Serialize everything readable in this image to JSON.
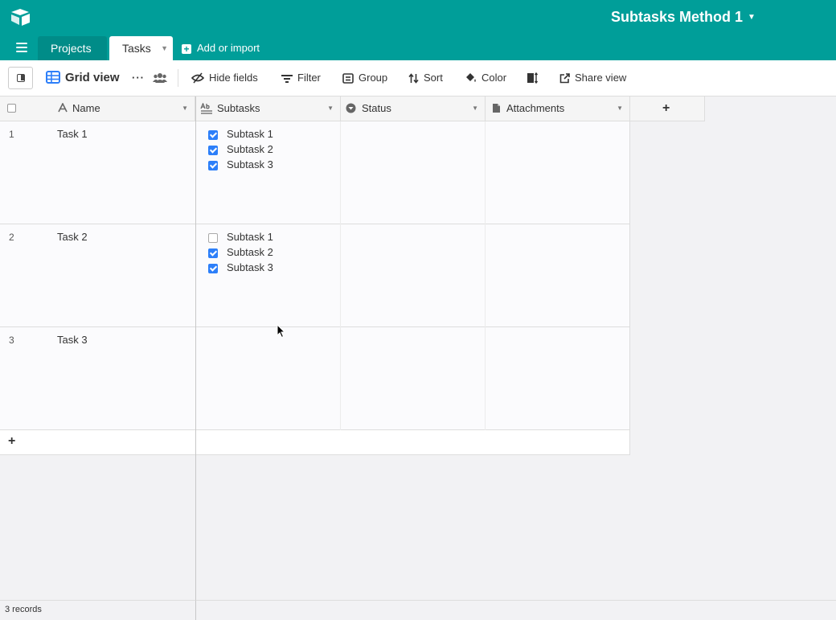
{
  "header": {
    "base_title": "Subtasks Method 1",
    "colors": {
      "brand": "#009e99",
      "accent": "#2d7ff9"
    }
  },
  "tabs": [
    {
      "label": "Projects",
      "active": false
    },
    {
      "label": "Tasks",
      "active": true
    }
  ],
  "add_import_label": "Add or import",
  "toolbar": {
    "view_name": "Grid view",
    "hide_fields": "Hide fields",
    "filter": "Filter",
    "group": "Group",
    "sort": "Sort",
    "color": "Color",
    "share_view": "Share view"
  },
  "columns": [
    {
      "label": "Name",
      "icon": "text-icon"
    },
    {
      "label": "Subtasks",
      "icon": "long-text-icon"
    },
    {
      "label": "Status",
      "icon": "single-select-icon"
    },
    {
      "label": "Attachments",
      "icon": "attachment-icon"
    }
  ],
  "rows": [
    {
      "num": "1",
      "name": "Task 1",
      "subtasks": [
        {
          "label": "Subtask 1",
          "checked": true
        },
        {
          "label": "Subtask 2",
          "checked": true
        },
        {
          "label": "Subtask 3",
          "checked": true
        }
      ]
    },
    {
      "num": "2",
      "name": "Task 2",
      "subtasks": [
        {
          "label": "Subtask 1",
          "checked": false
        },
        {
          "label": "Subtask 2",
          "checked": true
        },
        {
          "label": "Subtask 3",
          "checked": true
        }
      ]
    },
    {
      "num": "3",
      "name": "Task 3",
      "subtasks": []
    }
  ],
  "footer": {
    "record_count": "3 records"
  }
}
